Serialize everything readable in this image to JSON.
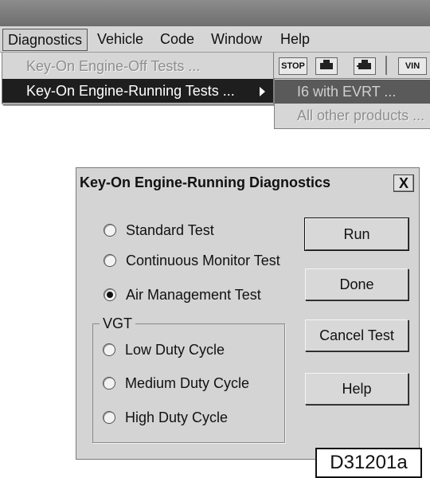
{
  "menubar": {
    "items": [
      "Diagnostics",
      "Vehicle",
      "Code",
      "Window",
      "Help"
    ]
  },
  "diagnostics_menu": {
    "items": [
      {
        "label": "Key-On Engine-Off Tests ..."
      },
      {
        "label": "Key-On Engine-Running Tests ..."
      }
    ]
  },
  "submenu": {
    "items": [
      {
        "label": "I6 with EVRT ..."
      },
      {
        "label": "All other products ..."
      }
    ]
  },
  "toolbar": {
    "stop_label": "STOP",
    "vin_label": "VIN"
  },
  "dialog": {
    "title": "Key-On Engine-Running Diagnostics",
    "close_label": "X",
    "tests": [
      {
        "label": "Standard Test",
        "selected": false
      },
      {
        "label": "Continuous Monitor Test",
        "selected": false
      },
      {
        "label": "Air Management Test",
        "selected": true
      }
    ],
    "vgt": {
      "legend": "VGT",
      "options": [
        {
          "label": "Low Duty Cycle",
          "selected": false
        },
        {
          "label": "Medium Duty Cycle",
          "selected": false
        },
        {
          "label": "High Duty Cycle",
          "selected": false
        }
      ]
    },
    "buttons": {
      "run": "Run",
      "done": "Done",
      "cancel": "Cancel Test",
      "help": "Help"
    }
  },
  "figure_label": "D31201a"
}
